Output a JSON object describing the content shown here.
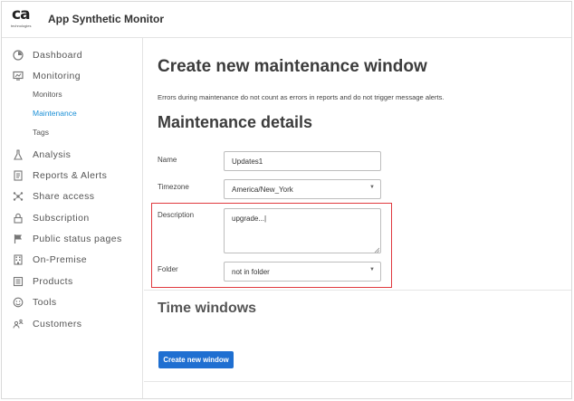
{
  "app": {
    "logo_text": "ca",
    "logo_sub": "technologies",
    "title": "App Synthetic Monitor"
  },
  "sidebar": {
    "items": [
      {
        "label": "Dashboard",
        "icon": "dashboard-icon"
      },
      {
        "label": "Monitoring",
        "icon": "monitor-icon"
      },
      {
        "label": "Analysis",
        "icon": "flask-icon"
      },
      {
        "label": "Reports & Alerts",
        "icon": "report-icon"
      },
      {
        "label": "Share access",
        "icon": "share-icon"
      },
      {
        "label": "Subscription",
        "icon": "lock-icon"
      },
      {
        "label": "Public status pages",
        "icon": "flag-icon"
      },
      {
        "label": "On-Premise",
        "icon": "building-icon"
      },
      {
        "label": "Products",
        "icon": "products-icon"
      },
      {
        "label": "Tools",
        "icon": "tools-icon"
      },
      {
        "label": "Customers",
        "icon": "customers-icon"
      }
    ],
    "monitoring_sub": [
      {
        "label": "Monitors",
        "active": false
      },
      {
        "label": "Maintenance",
        "active": true
      },
      {
        "label": "Tags",
        "active": false
      }
    ]
  },
  "main": {
    "page_title": "Create new maintenance window",
    "intro": "Errors during maintenance do not count as errors in reports and do not trigger message alerts.",
    "section_title": "Maintenance details",
    "form": {
      "name_label": "Name",
      "name_value": "Updates1",
      "timezone_label": "Timezone",
      "timezone_value": "America/New_York",
      "description_label": "Description",
      "description_value": "upgrade...|",
      "folder_label": "Folder",
      "folder_value": "not in folder"
    },
    "time_windows_title": "Time windows",
    "create_button": "Create new window"
  },
  "colors": {
    "accent": "#1f6fd1",
    "active_link": "#1a8fd6",
    "highlight": "#e0393e"
  }
}
